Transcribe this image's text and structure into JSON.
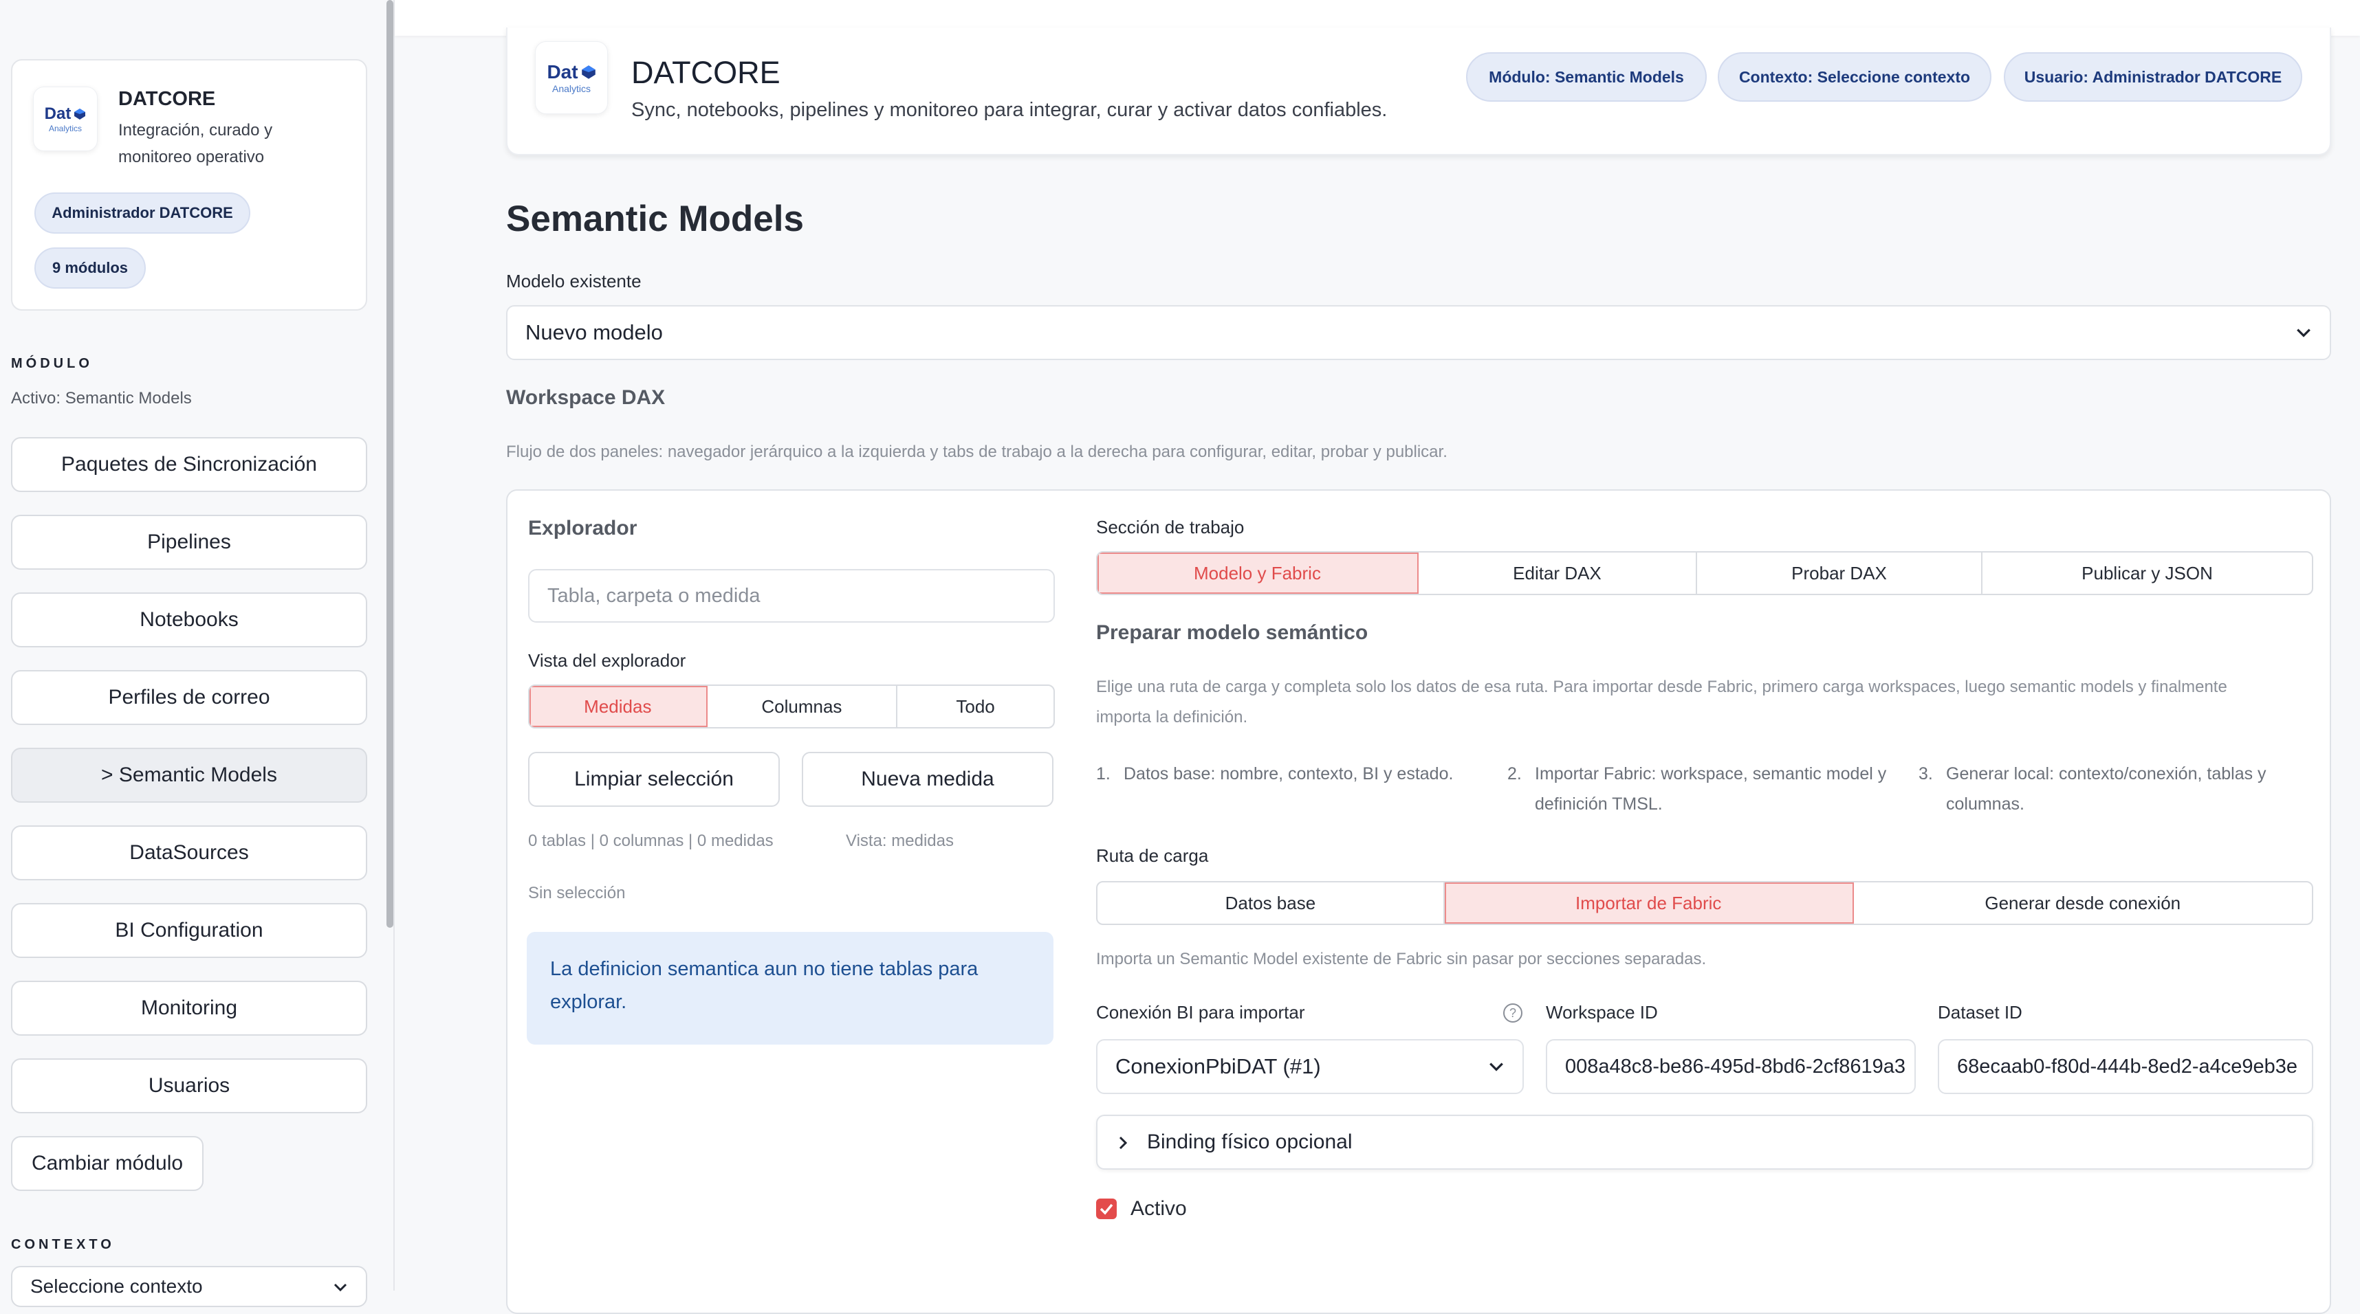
{
  "sidebar": {
    "brand": {
      "logo_text": "Dat",
      "logo_sub": "Analytics",
      "title": "DATCORE",
      "subtitle": "Integración, curado y monitoreo operativo"
    },
    "role_pill": "Administrador DATCORE",
    "modules_pill": "9 módulos",
    "module_section": {
      "label": "MÓDULO",
      "value": "Activo: Semantic Models"
    },
    "nav_items": [
      {
        "label": "Paquetes de Sincronización"
      },
      {
        "label": "Pipelines"
      },
      {
        "label": "Notebooks"
      },
      {
        "label": "Perfiles de correo"
      },
      {
        "label": "> Semantic Models"
      },
      {
        "label": "DataSources"
      },
      {
        "label": "BI Configuration"
      },
      {
        "label": "Monitoring"
      },
      {
        "label": "Usuarios"
      }
    ],
    "change_module": "Cambiar módulo",
    "context_section": {
      "label": "CONTEXTO",
      "select_value": "Seleccione contexto"
    }
  },
  "header": {
    "logo_text": "Dat",
    "logo_sub": "Analytics",
    "title": "DATCORE",
    "subtitle": "Sync, notebooks, pipelines y monitoreo para integrar, curar y activar datos confiables.",
    "badges": [
      "Módulo: Semantic Models",
      "Contexto: Seleccione contexto",
      "Usuario: Administrador DATCORE"
    ]
  },
  "page": {
    "title": "Semantic Models",
    "model_label": "Modelo existente",
    "model_value": "Nuevo modelo",
    "workspace_title": "Workspace DAX",
    "workspace_desc": "Flujo de dos paneles: navegador jerárquico a la izquierda y tabs de trabajo a la derecha para configurar, editar, probar y publicar."
  },
  "explorer": {
    "title": "Explorador",
    "search_placeholder": "Tabla, carpeta o medida",
    "view_label": "Vista del explorador",
    "view_options": [
      "Medidas",
      "Columnas",
      "Todo"
    ],
    "clear_button": "Limpiar selección",
    "new_button": "Nueva medida",
    "counts": "0 tablas | 0 columnas | 0 medidas",
    "view_status": "Vista: medidas",
    "selection": "Sin selección",
    "info": "La definicion semantica aun no tiene tablas para explorar."
  },
  "work": {
    "section_label": "Sección de trabajo",
    "tabs": [
      "Modelo y Fabric",
      "Editar DAX",
      "Probar DAX",
      "Publicar y JSON"
    ],
    "prepare_title": "Preparar modelo semántico",
    "prepare_desc": "Elige una ruta de carga y completa solo los datos de esa ruta. Para importar desde Fabric, primero carga workspaces, luego semantic models y finalmente importa la definición.",
    "steps": [
      {
        "num": "1.",
        "text": "Datos base: nombre, contexto, BI y estado."
      },
      {
        "num": "2.",
        "text": "Importar Fabric: workspace, semantic model y definición TMSL."
      },
      {
        "num": "3.",
        "text": "Generar local: contexto/conexión, tablas y columnas."
      }
    ],
    "route_label": "Ruta de carga",
    "routes": [
      "Datos base",
      "Importar de Fabric",
      "Generar desde conexión"
    ],
    "route_desc": "Importa un Semantic Model existente de Fabric sin pasar por secciones separadas.",
    "bi_label": "Conexión BI para importar",
    "bi_value": "ConexionPbiDAT (#1)",
    "workspace_label": "Workspace ID",
    "workspace_value": "008a48c8-be86-495d-8bd6-2cf8619a3",
    "dataset_label": "Dataset ID",
    "dataset_value": "68ecaab0-f80d-444b-8ed2-a4ce9eb3e",
    "binding_label": "Binding físico opcional",
    "active_label": "Activo"
  }
}
